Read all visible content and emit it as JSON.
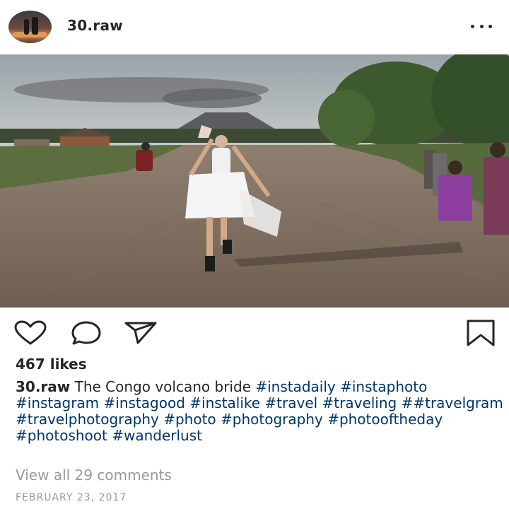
{
  "post": {
    "username": "30.raw",
    "likes": "467 likes",
    "caption_user": "30.raw",
    "caption_text": "The Congo volcano bride",
    "hashtags": "#instadaily #instaphoto #instagram #instagood #instalike #travel #traveling ##travelgram #travelphotography #photo #photography #photooftheday #photoshoot #wanderlust",
    "view_comments": "View all 29 comments",
    "date": "FEBRUARY 23, 2017"
  },
  "icons": {
    "more": "more-options-icon",
    "like": "heart-icon",
    "comment": "comment-icon",
    "share": "paper-plane-icon",
    "save": "bookmark-icon"
  },
  "colors": {
    "text": "#262626",
    "hashtag": "#003569",
    "muted": "#999999"
  }
}
